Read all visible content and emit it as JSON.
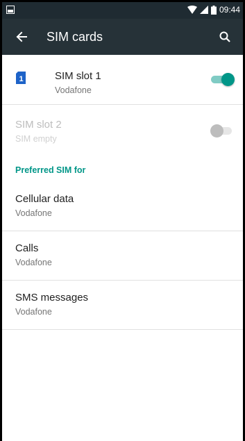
{
  "status_bar": {
    "time": "09:44",
    "icons": [
      "notification-icon",
      "wifi-icon",
      "signal-icon",
      "battery-icon"
    ]
  },
  "app_bar": {
    "title": "SIM cards",
    "back_icon": "arrow-back-icon",
    "search_icon": "search-icon"
  },
  "sim_slots": [
    {
      "title": "SIM slot 1",
      "subtitle": "Vodafone",
      "badge": "1",
      "enabled": true,
      "toggle_on": true
    },
    {
      "title": "SIM slot 2",
      "subtitle": "SIM empty",
      "enabled": false,
      "toggle_on": false
    }
  ],
  "preferred": {
    "header": "Preferred SIM for",
    "items": [
      {
        "title": "Cellular data",
        "value": "Vodafone"
      },
      {
        "title": "Calls",
        "value": "Vodafone"
      },
      {
        "title": "SMS messages",
        "value": "Vodafone"
      }
    ]
  },
  "colors": {
    "accent": "#009688",
    "toolbar": "#263238",
    "status_bar": "#1f2b32",
    "sim_icon": "#1e63c8"
  }
}
